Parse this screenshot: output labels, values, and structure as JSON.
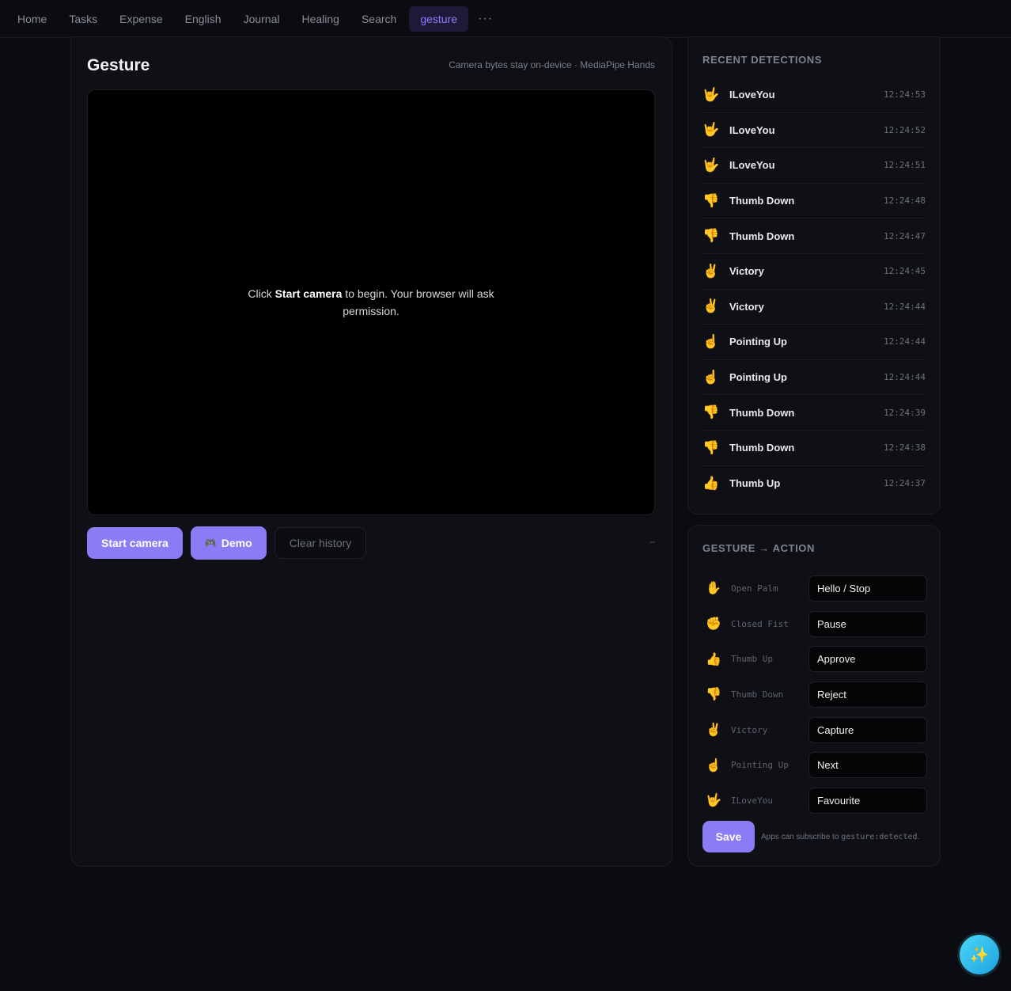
{
  "nav": {
    "items": [
      "Home",
      "Tasks",
      "Expense",
      "English",
      "Journal",
      "Healing",
      "Search"
    ],
    "active": "gesture",
    "more": "···"
  },
  "main": {
    "title": "Gesture",
    "subtitle": "Camera bytes stay on-device · MediaPipe Hands",
    "video_msg_pre": "Click ",
    "video_msg_bold": "Start camera",
    "video_msg_post": " to begin. Your browser will ask permission.",
    "buttons": {
      "start": "Start camera",
      "demo_icon": "🎮",
      "demo": "Demo",
      "clear": "Clear history"
    },
    "status": "–"
  },
  "recent": {
    "heading": "RECENT DETECTIONS",
    "items": [
      {
        "emoji": "🤟",
        "name": "ILoveYou",
        "time": "12:24:53"
      },
      {
        "emoji": "🤟",
        "name": "ILoveYou",
        "time": "12:24:52"
      },
      {
        "emoji": "🤟",
        "name": "ILoveYou",
        "time": "12:24:51"
      },
      {
        "emoji": "👎",
        "name": "Thumb Down",
        "time": "12:24:48"
      },
      {
        "emoji": "👎",
        "name": "Thumb Down",
        "time": "12:24:47"
      },
      {
        "emoji": "✌️",
        "name": "Victory",
        "time": "12:24:45"
      },
      {
        "emoji": "✌️",
        "name": "Victory",
        "time": "12:24:44"
      },
      {
        "emoji": "☝️",
        "name": "Pointing Up",
        "time": "12:24:44"
      },
      {
        "emoji": "☝️",
        "name": "Pointing Up",
        "time": "12:24:44"
      },
      {
        "emoji": "👎",
        "name": "Thumb Down",
        "time": "12:24:39"
      },
      {
        "emoji": "👎",
        "name": "Thumb Down",
        "time": "12:24:38"
      },
      {
        "emoji": "👍",
        "name": "Thumb Up",
        "time": "12:24:37"
      }
    ]
  },
  "mapping": {
    "heading": "GESTURE → ACTION",
    "rows": [
      {
        "emoji": "✋",
        "gesture": "Open Palm",
        "action": "Hello / Stop"
      },
      {
        "emoji": "✊",
        "gesture": "Closed Fist",
        "action": "Pause"
      },
      {
        "emoji": "👍",
        "gesture": "Thumb Up",
        "action": "Approve"
      },
      {
        "emoji": "👎",
        "gesture": "Thumb Down",
        "action": "Reject"
      },
      {
        "emoji": "✌️",
        "gesture": "Victory",
        "action": "Capture"
      },
      {
        "emoji": "☝️",
        "gesture": "Pointing Up",
        "action": "Next"
      },
      {
        "emoji": "🤟",
        "gesture": "ILoveYou",
        "action": "Favourite"
      }
    ],
    "save": "Save",
    "note_pre": "Apps can subscribe to ",
    "note_code": "gesture:detected",
    "note_post": "."
  },
  "fab": {
    "icon": "✨",
    "icon_name": "sparkles-icon"
  },
  "colors": {
    "accent": "#8b7bf5",
    "active_nav": "#8f7cff",
    "fab": "#2fb8ea"
  }
}
